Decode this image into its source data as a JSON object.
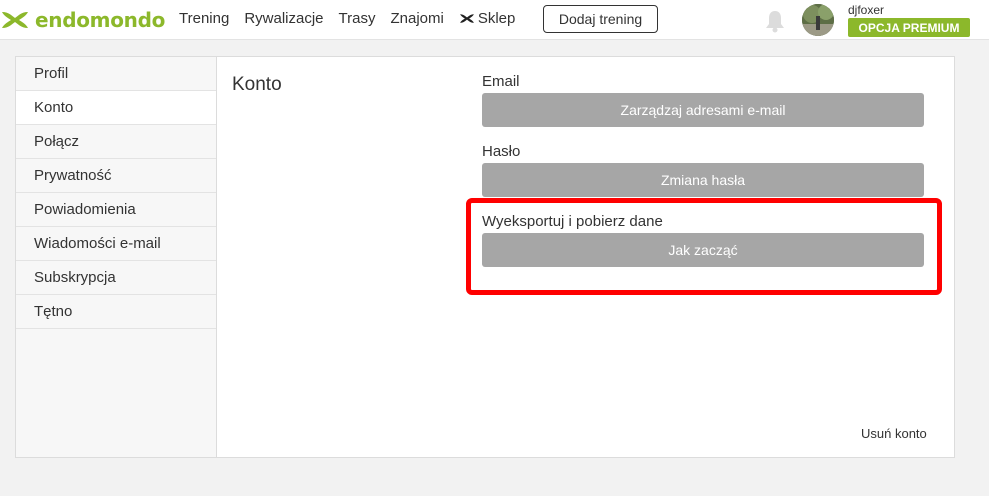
{
  "brand": {
    "name": "endomondo",
    "color": "#8cb82b"
  },
  "nav": {
    "items": [
      "Trening",
      "Rywalizacje",
      "Trasy",
      "Znajomi"
    ],
    "shop": "Sklep",
    "add_training": "Dodaj trening"
  },
  "user": {
    "name": "djfoxer",
    "premium_label": "OPCJA PREMIUM"
  },
  "sidebar": {
    "items": [
      {
        "label": "Profil"
      },
      {
        "label": "Konto"
      },
      {
        "label": "Połącz"
      },
      {
        "label": "Prywatność"
      },
      {
        "label": "Powiadomienia"
      },
      {
        "label": "Wiadomości e-mail"
      },
      {
        "label": "Subskrypcja"
      },
      {
        "label": "Tętno"
      }
    ],
    "active": "Konto"
  },
  "main": {
    "title": "Konto",
    "email": {
      "label": "Email",
      "button": "Zarządzaj adresami e-mail"
    },
    "password": {
      "label": "Hasło",
      "button": "Zmiana hasła"
    },
    "export": {
      "label": "Wyeksportuj i pobierz dane",
      "button": "Jak zacząć"
    },
    "delete_account": "Usuń konto"
  },
  "colors": {
    "highlight": "#ff0000",
    "button_gray": "#a6a6a6",
    "premium": "#8cb82b"
  }
}
